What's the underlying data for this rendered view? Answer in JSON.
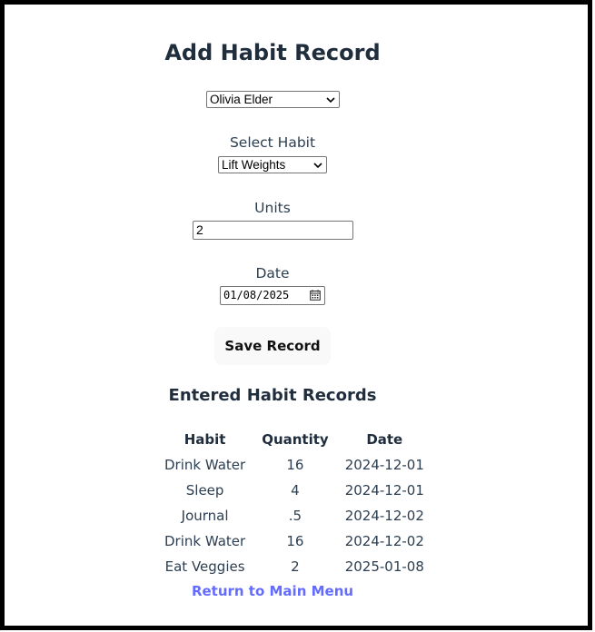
{
  "page": {
    "title": "Add Habit Record"
  },
  "form": {
    "user_select_value": "Olivia Elder",
    "habit_label": "Select Habit",
    "habit_select_value": "Lift Weights",
    "units_label": "Units",
    "units_value": "2",
    "date_label": "Date",
    "date_value": "01/08/2025",
    "save_label": "Save Record"
  },
  "records": {
    "heading": "Entered Habit Records",
    "columns": [
      "Habit",
      "Quantity",
      "Date"
    ],
    "rows": [
      [
        "Drink Water",
        "16",
        "2024-12-01"
      ],
      [
        "Sleep",
        "4",
        "2024-12-01"
      ],
      [
        "Journal",
        ".5",
        "2024-12-02"
      ],
      [
        "Drink Water",
        "16",
        "2024-12-02"
      ],
      [
        "Eat Veggies",
        "2",
        "2025-01-08"
      ]
    ]
  },
  "nav": {
    "return_label": "Return to Main Menu"
  },
  "colors": {
    "link": "#646cff",
    "heading": "#1f2d3d",
    "border": "#000000"
  }
}
